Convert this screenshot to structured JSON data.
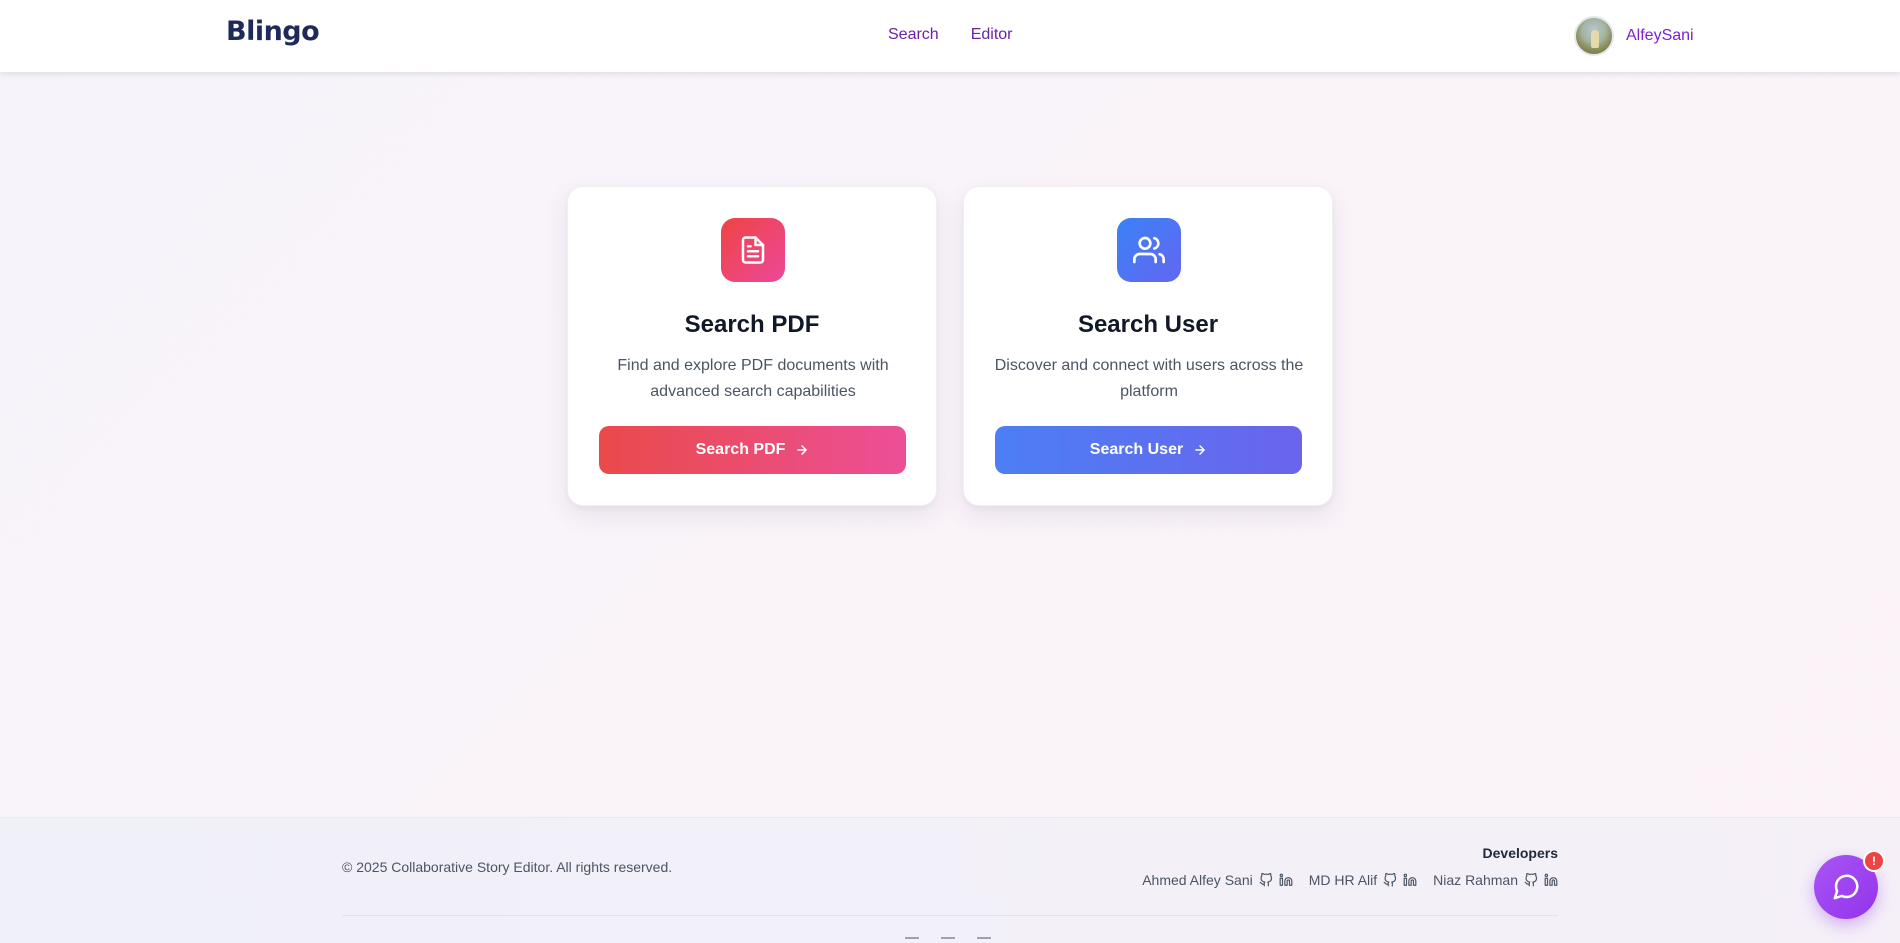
{
  "header": {
    "logo": "Blingo",
    "nav": [
      {
        "label": "Search"
      },
      {
        "label": "Editor"
      }
    ],
    "user": {
      "name": "AlfeySani"
    }
  },
  "cards": {
    "pdf": {
      "title": "Search PDF",
      "description": "Find and explore PDF documents with advanced search capabilities",
      "button_label": "Search PDF",
      "icon": "file-text-icon"
    },
    "user": {
      "title": "Search User",
      "description": "Discover and connect with users across the platform",
      "button_label": "Search User",
      "icon": "users-icon"
    }
  },
  "footer": {
    "copyright": "© 2025 Collaborative Story Editor. All rights reserved.",
    "developers_title": "Developers",
    "developers": [
      {
        "name": "Ahmed Alfey Sani"
      },
      {
        "name": "MD HR Alif"
      },
      {
        "name": "Niaz Rahman"
      }
    ]
  },
  "chat": {
    "badge": "!"
  },
  "colors": {
    "brand_navy": "#1e2a5a",
    "nav_purple": "#6b21a8",
    "pdf_gradient": [
      "#ef4444",
      "#ec4899"
    ],
    "user_gradient": [
      "#3b82f6",
      "#6366f1"
    ],
    "chat_purple": "#9333ea",
    "badge_red": "#ef4444"
  }
}
